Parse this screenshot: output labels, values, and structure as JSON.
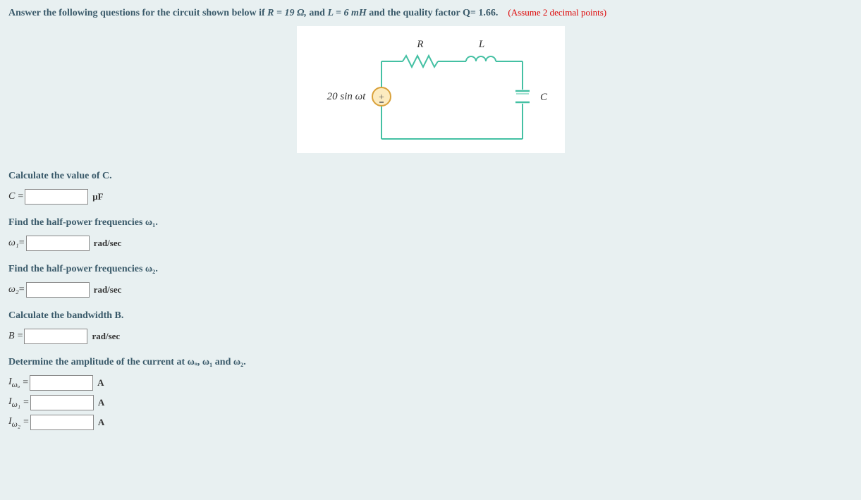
{
  "question": {
    "prefix": "Answer the following questions for the circuit shown below if ",
    "R_eq": "R = 19 Ω,",
    "and_text": " and ",
    "L_eq": "L = 6 mH",
    "suffix": " and the quality factor Q= 1.66.",
    "assume": "(Assume 2 decimal points)"
  },
  "circuit": {
    "source": "20 sin ωt",
    "R": "R",
    "L": "L",
    "C": "C"
  },
  "sections": {
    "calc_c": {
      "title": "Calculate the value of C.",
      "label": "C",
      "eq": "=",
      "unit": "μF"
    },
    "w1": {
      "title": "Find the half-power frequencies ω₁.",
      "label": "ω₁",
      "eq": " =",
      "unit": "rad/sec"
    },
    "w2": {
      "title": "Find the half-power frequencies ω₂.",
      "label": "ω₂",
      "eq": " =",
      "unit": "rad/sec"
    },
    "B": {
      "title": "Calculate the bandwidth B.",
      "label": "B",
      "eq": "=",
      "unit": "rad/sec"
    },
    "current": {
      "title": "Determine the amplitude of the current at ωₒ, ω₁ and ω₂.",
      "rows": [
        {
          "label_main": "I",
          "label_sub": "ωₒ",
          "eq": " =",
          "unit": "A"
        },
        {
          "label_main": "I",
          "label_sub": "ω₁",
          "eq": " =",
          "unit": "A"
        },
        {
          "label_main": "I",
          "label_sub": "ω₂",
          "eq": " =",
          "unit": "A"
        }
      ]
    }
  }
}
